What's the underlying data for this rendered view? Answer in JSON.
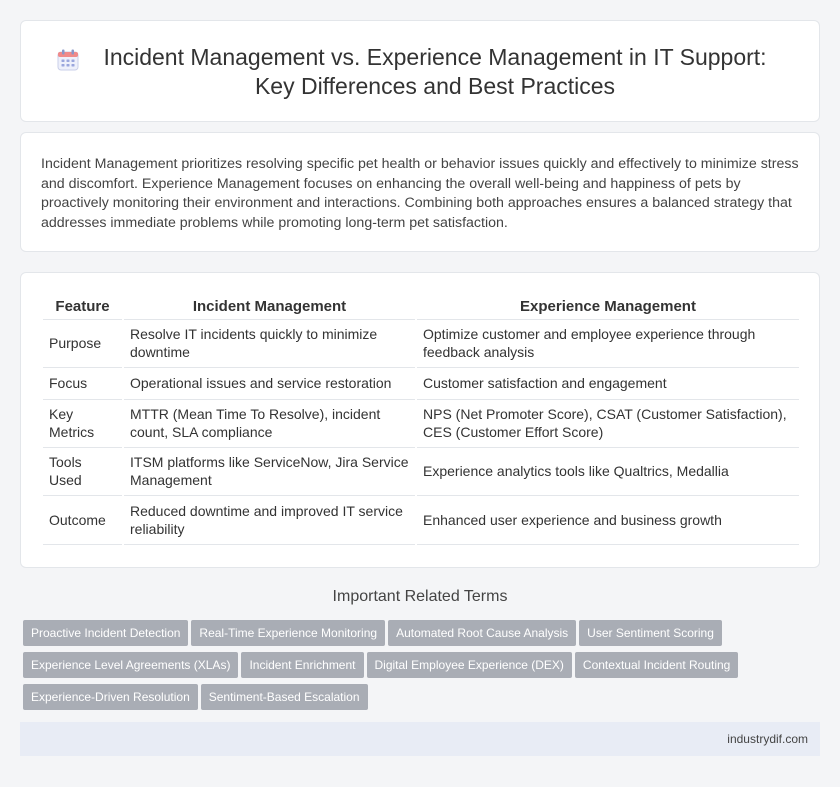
{
  "header": {
    "title": "Incident Management vs. Experience Management in IT Support: Key Differences and Best Practices",
    "icon": "calendar-icon"
  },
  "intro": {
    "text": "Incident Management prioritizes resolving specific pet health or behavior issues quickly and effectively to minimize stress and discomfort. Experience Management focuses on enhancing the overall well-being and happiness of pets by proactively monitoring their environment and interactions. Combining both approaches ensures a balanced strategy that addresses immediate problems while promoting long-term pet satisfaction."
  },
  "table": {
    "headers": [
      "Feature",
      "Incident Management",
      "Experience Management"
    ],
    "rows": [
      [
        "Purpose",
        "Resolve IT incidents quickly to minimize downtime",
        "Optimize customer and employee experience through feedback analysis"
      ],
      [
        "Focus",
        "Operational issues and service restoration",
        "Customer satisfaction and engagement"
      ],
      [
        "Key Metrics",
        "MTTR (Mean Time To Resolve), incident count, SLA compliance",
        "NPS (Net Promoter Score), CSAT (Customer Satisfaction), CES (Customer Effort Score)"
      ],
      [
        "Tools Used",
        "ITSM platforms like ServiceNow, Jira Service Management",
        "Experience analytics tools like Qualtrics, Medallia"
      ],
      [
        "Outcome",
        "Reduced downtime and improved IT service reliability",
        "Enhanced user experience and business growth"
      ]
    ]
  },
  "related": {
    "title": "Important Related Terms",
    "tags": [
      "Proactive Incident Detection",
      "Real-Time Experience Monitoring",
      "Automated Root Cause Analysis",
      "User Sentiment Scoring",
      "Experience Level Agreements (XLAs)",
      "Incident Enrichment",
      "Digital Employee Experience (DEX)",
      "Contextual Incident Routing",
      "Experience-Driven Resolution",
      "Sentiment-Based Escalation"
    ]
  },
  "footer": {
    "site": "industrydif.com"
  },
  "colors": {
    "tag_bg": "#a9adb5",
    "footer_bg": "#e8ecf5",
    "icon_accent": "#7b8fe0"
  }
}
